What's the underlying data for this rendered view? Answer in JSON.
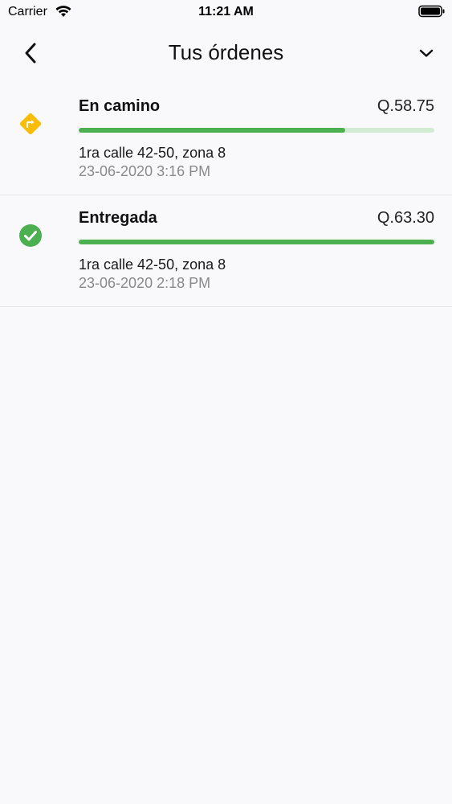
{
  "status_bar": {
    "carrier": "Carrier",
    "time": "11:21 AM",
    "icons": [
      "wifi-icon",
      "battery-icon"
    ]
  },
  "header": {
    "title": "Tus órdenes",
    "icons": [
      "back-arrow-icon",
      "chevron-down-icon"
    ]
  },
  "colors": {
    "progress": "#4caf50",
    "progress_track": "#d2ebd3",
    "in_transit": "#fbbc05",
    "delivered": "#4caf50"
  },
  "orders": [
    {
      "status": "En camino",
      "amount": "Q.58.75",
      "progress": 0.75,
      "address": "1ra calle 42-50, zona 8",
      "datetime": "23-06-2020 3:16 PM",
      "icon": "directions-diamond-icon"
    },
    {
      "status": "Entregada",
      "amount": "Q.63.30",
      "progress": 1.0,
      "address": "1ra calle 42-50, zona 8",
      "datetime": "23-06-2020 2:18 PM",
      "icon": "check-circle-icon"
    }
  ]
}
